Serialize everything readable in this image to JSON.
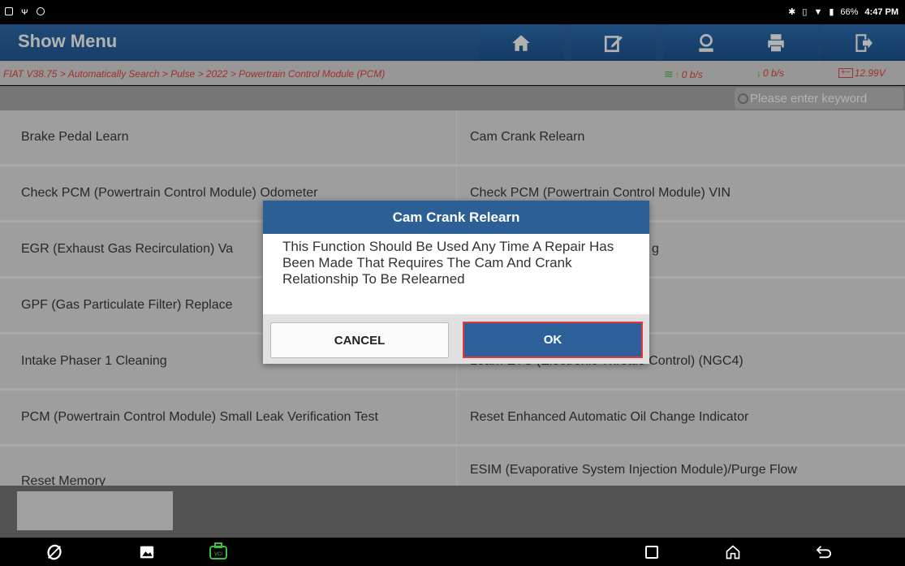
{
  "status_bar": {
    "battery": "66%",
    "time": "4:47 PM"
  },
  "header": {
    "title": "Show Menu",
    "buttons": [
      "home-icon",
      "edit-report-icon",
      "user-icon",
      "print-icon",
      "exit-icon"
    ]
  },
  "breadcrumb": {
    "path": "FIAT V38.75 > Automatically Search > Pulse > 2022 > Powertrain Control Module (PCM)",
    "upload_rate": "0 b/s",
    "download_rate": "0 b/s",
    "voltage": "12.99V"
  },
  "search": {
    "placeholder": "Please enter keyword"
  },
  "menu": {
    "rows": [
      {
        "left": "Brake Pedal Learn",
        "right": "Cam Crank Relearn"
      },
      {
        "left": "Check PCM (Powertrain Control Module) Odometer",
        "right": "Check PCM (Powertrain Control Module) VIN"
      },
      {
        "left": "EGR (Exhaust Gas Recirculation) Va",
        "right": "g"
      },
      {
        "left": "GPF (Gas Particulate Filter) Replace",
        "right": ""
      },
      {
        "left": "Intake Phaser 1 Cleaning",
        "right": "Learn ETC (Electronic Throttle Control) (NGC4)"
      },
      {
        "left": "PCM (Powertrain Control Module) Small Leak Verification Test",
        "right": "Reset Enhanced Automatic Oil Change Indicator"
      },
      {
        "left": "Reset Memory",
        "right": "ESIM (Evaporative System Injection Module)/Purge Flow"
      }
    ]
  },
  "dialog": {
    "title": "Cam Crank Relearn",
    "message": "This Function Should Be Used Any Time A Repair Has Been Made That Requires The Cam And Crank Relationship To Be Relearned",
    "cancel_label": "CANCEL",
    "ok_label": "OK"
  },
  "colors": {
    "header_blue": "#2f6aa9",
    "breadcrumb_red": "#e8443a",
    "ok_border": "#e23a3a",
    "vci_green": "#3fbf3f"
  }
}
